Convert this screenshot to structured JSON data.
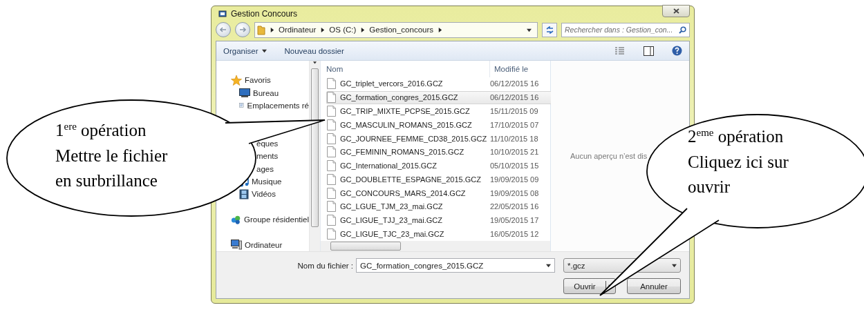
{
  "window": {
    "title": "Gestion Concours"
  },
  "address_bar": {
    "path": [
      "Ordinateur",
      "OS (C:)",
      "Gestion_concours"
    ]
  },
  "search": {
    "placeholder": "Rechercher dans : Gestion_con..."
  },
  "toolbar": {
    "buttons": [
      {
        "label": "Organiser",
        "dropdown": true
      },
      {
        "label": "Nouveau dossier",
        "dropdown": false
      }
    ]
  },
  "sidebar": {
    "items": [
      {
        "kind": "group",
        "label": "Favoris"
      },
      {
        "kind": "item",
        "label": "Bureau"
      },
      {
        "kind": "item",
        "label": "Emplacements ré"
      },
      {
        "kind": "gap"
      },
      {
        "kind": "gap"
      },
      {
        "kind": "clipped",
        "label": "èques"
      },
      {
        "kind": "clipped",
        "label": "ments"
      },
      {
        "kind": "clipped",
        "label": "ages"
      },
      {
        "kind": "item",
        "label": "Musique"
      },
      {
        "kind": "item",
        "label": "Vidéos"
      },
      {
        "kind": "gap"
      },
      {
        "kind": "group",
        "label": "Groupe résidentiel"
      },
      {
        "kind": "gap"
      },
      {
        "kind": "group",
        "label": "Ordinateur"
      }
    ]
  },
  "files": {
    "columns": [
      "Nom",
      "Modifié le"
    ],
    "rows": [
      {
        "name": "GC_triplet_vercors_2016.GCZ",
        "modified": "06/12/2015 16",
        "selected": false
      },
      {
        "name": "GC_formation_congres_2015.GCZ",
        "modified": "06/12/2015 16",
        "selected": true
      },
      {
        "name": "GC_TRIP_MIXTE_PCPSE_2015.GCZ",
        "modified": "15/11/2015 09",
        "selected": false
      },
      {
        "name": "GC_MASCULIN_ROMANS_2015.GCZ",
        "modified": "17/10/2015 07",
        "selected": false
      },
      {
        "name": "GC_JOURNEE_FEMME_CD38_2015.GCZ",
        "modified": "11/10/2015 18",
        "selected": false
      },
      {
        "name": "GC_FEMININ_ROMANS_2015.GCZ",
        "modified": "10/10/2015 21",
        "selected": false
      },
      {
        "name": "GC_International_2015.GCZ",
        "modified": "05/10/2015 15",
        "selected": false
      },
      {
        "name": "GC_DOUBLETTE_ESPAGNE_2015.GCZ",
        "modified": "19/09/2015 09",
        "selected": false
      },
      {
        "name": "GC_CONCOURS_MARS_2014.GCZ",
        "modified": "19/09/2015 08",
        "selected": false
      },
      {
        "name": "GC_LGUE_TJM_23_mai.GCZ",
        "modified": "22/05/2015 16",
        "selected": false
      },
      {
        "name": "GC_LIGUE_TJJ_23_mai.GCZ",
        "modified": "19/05/2015 17",
        "selected": false
      },
      {
        "name": "GC_LIGUE_TJC_23_mai.GCZ",
        "modified": "16/05/2015 12",
        "selected": false
      }
    ]
  },
  "preview": {
    "message": "Aucun aperçu n’est dis"
  },
  "filename": {
    "label": "Nom du fichier :",
    "value": "GC_formation_congres_2015.GCZ"
  },
  "filter": {
    "value": "*.gcz"
  },
  "buttons": [
    {
      "label": "Ouvrir",
      "kind": "split"
    },
    {
      "label": "Annuler",
      "kind": "plain"
    }
  ],
  "callouts": [
    {
      "lines": [
        "1$^{ere}$ opération",
        "Mettre le fichier",
        "en surbrillance"
      ]
    },
    {
      "lines": [
        "2$^{eme}$ opération",
        "Cliquez ici sur",
        "ouvrir"
      ]
    }
  ]
}
